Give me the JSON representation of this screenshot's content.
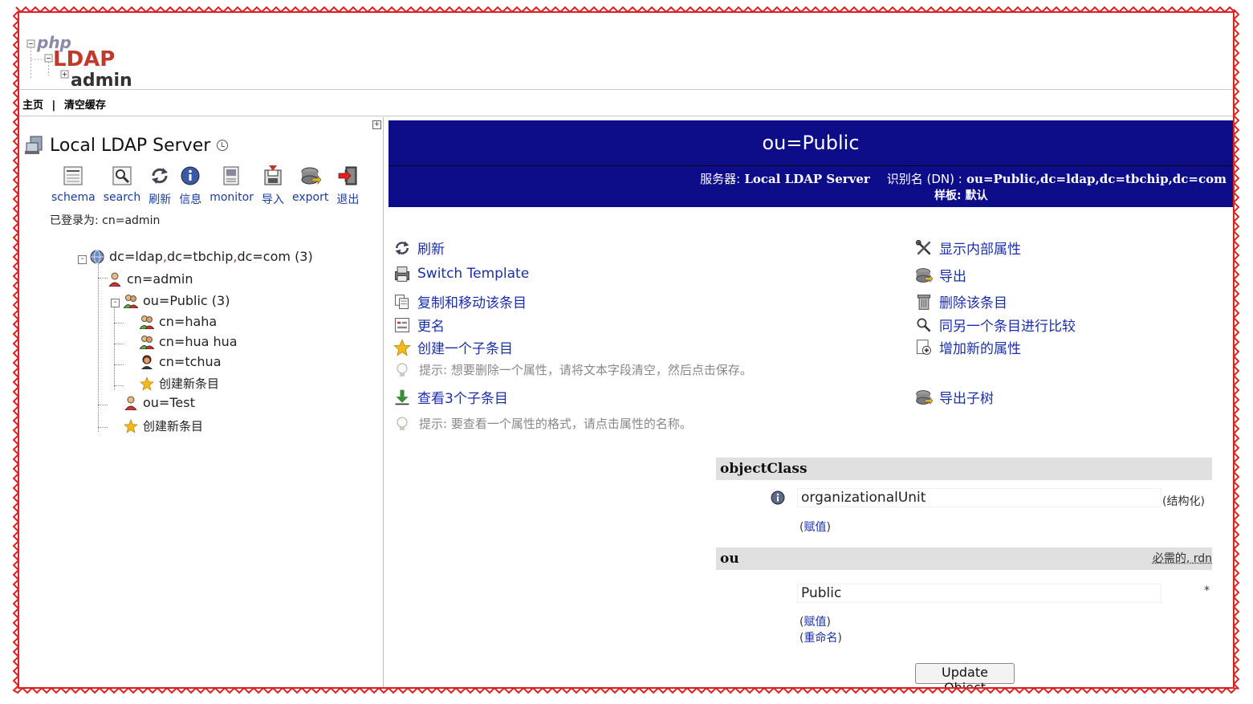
{
  "logo": {
    "line1": "php",
    "line2": "LDAP",
    "line3": "admin"
  },
  "topnav": {
    "home": "主页",
    "separator": "|",
    "clear_cache": "清空缓存"
  },
  "left": {
    "server_name": "Local LDAP Server",
    "toolbar": [
      {
        "label": "schema",
        "icon": "schema-icon"
      },
      {
        "label": "search",
        "icon": "search-icon"
      },
      {
        "label": "刷新",
        "icon": "refresh-icon"
      },
      {
        "label": "信息",
        "icon": "info-icon"
      },
      {
        "label": "monitor",
        "icon": "monitor-icon"
      },
      {
        "label": "导入",
        "icon": "import-icon"
      },
      {
        "label": "export",
        "icon": "export-icon"
      },
      {
        "label": "退出",
        "icon": "logout-icon"
      }
    ],
    "logged_in": "已登录为: cn=admin",
    "tree": {
      "root_part1": "dc=ldap",
      "comma": ",",
      "root_part2": "dc=tbchip",
      "root_part3": "dc=com",
      "root_count": "(3)",
      "n1": "cn=admin",
      "n2": "ou=Public (3)",
      "n2a": "cn=haha",
      "n2b": "cn=hua hua",
      "n2c": "cn=tchua",
      "n2d": "创建新条目",
      "n3": "ou=Test",
      "n4": "创建新条目"
    }
  },
  "right": {
    "dn_title": "ou=Public",
    "server_label": "服务器:",
    "server_value": "Local LDAP Server",
    "dn_label": "识别名 (DN) :",
    "dn_value": "ou=Public,dc=ldap,dc=tbchip,dc=com",
    "template_label": "样板:",
    "template_value": "默认",
    "actions_left": {
      "refresh": "刷新",
      "switch_template": "Switch Template",
      "copy_move": "复制和移动该条目",
      "rename": "更名",
      "create_child": "创建一个子条目",
      "hint1": "提示:  想要删除一个属性，请将文本字段清空，然后点击保存。",
      "view_children": "查看3个子条目",
      "hint2": "提示:  要查看一个属性的格式，请点击属性的名称。"
    },
    "actions_right": {
      "show_internal": "显示内部属性",
      "export": "导出",
      "delete": "删除该条目",
      "compare": "同另一个条目进行比较",
      "add_attr": "增加新的属性",
      "export_subtree": "导出子树"
    },
    "attrs": {
      "oc_name": "objectClass",
      "oc_value": "organizationalUnit",
      "oc_note": "(结构化)",
      "oc_add": "赋值",
      "ou_name": "ou",
      "ou_req": "必需的, rdn",
      "ou_value": "Public",
      "ou_star": "*",
      "ou_add": "赋值",
      "ou_rename": "重命名"
    },
    "update_button": "Update Object"
  },
  "colors": {
    "banner": "#0d0d8a",
    "link": "#1b2fa8",
    "frame": "#e02020"
  }
}
